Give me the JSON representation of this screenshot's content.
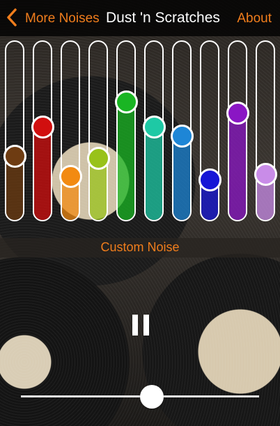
{
  "header": {
    "back_label": "More Noises",
    "title": "Dust 'n Scratches",
    "about_label": "About"
  },
  "noise_name": "Custom Noise",
  "sliders": [
    {
      "color": "#6e3c12",
      "level": 0.36
    },
    {
      "color": "#d10f0f",
      "level": 0.52
    },
    {
      "color": "#f28a12",
      "level": 0.25
    },
    {
      "color": "#98c21a",
      "level": 0.35
    },
    {
      "color": "#19b523",
      "level": 0.66
    },
    {
      "color": "#1ec9a5",
      "level": 0.52
    },
    {
      "color": "#1e86d6",
      "level": 0.47
    },
    {
      "color": "#1616d6",
      "level": 0.23
    },
    {
      "color": "#8a16c4",
      "level": 0.6
    },
    {
      "color": "#c98ce8",
      "level": 0.26
    }
  ],
  "player": {
    "state": "playing",
    "control_icon": "pause-icon",
    "volume": 0.55
  },
  "accent_color": "#f07d1c"
}
